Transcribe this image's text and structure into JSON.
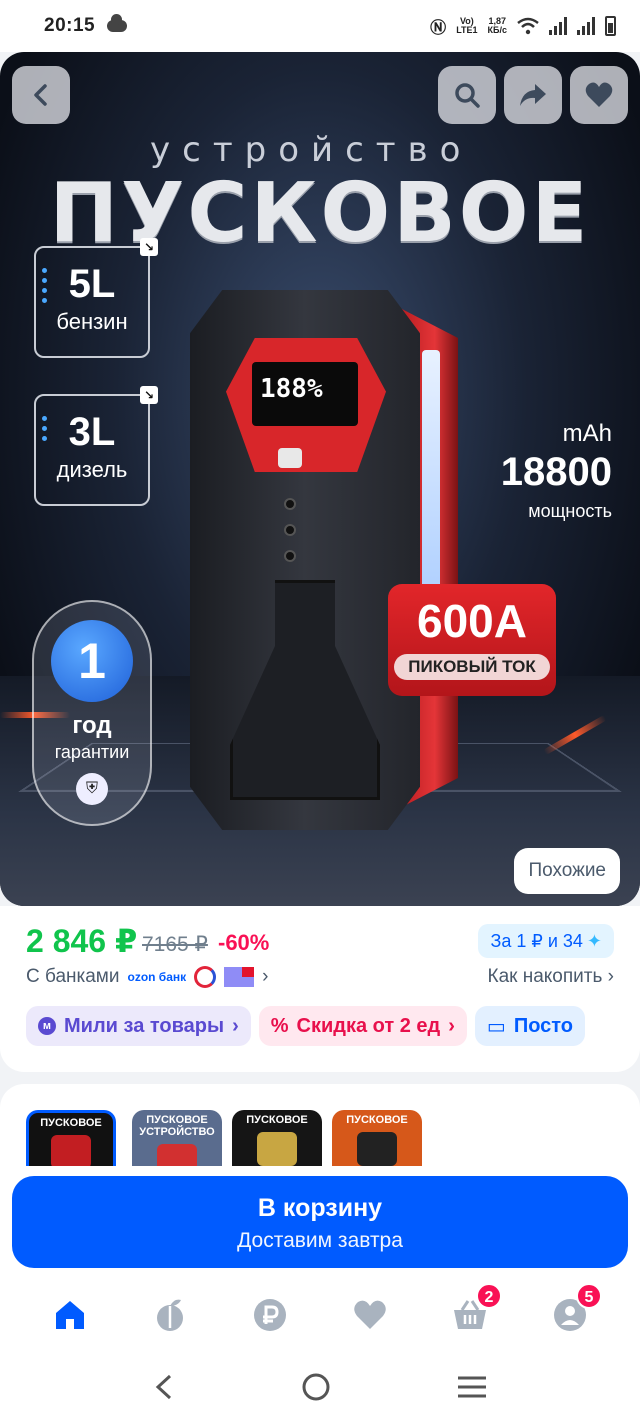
{
  "status_bar": {
    "time": "20:15",
    "lte_top": "Vo)",
    "lte_bottom": "LTE1",
    "speed_top": "1,87",
    "speed_bottom": "КБ/с",
    "icons": [
      "cloud-icon",
      "nfc-icon",
      "wifi-icon",
      "signal-icon",
      "signal-icon",
      "battery-icon"
    ]
  },
  "hero": {
    "subtitle": "устройство",
    "title": "ПУСКОВОЕ",
    "spec1": {
      "value": "5L",
      "label": "бензин"
    },
    "spec2": {
      "value": "3L",
      "label": "дизель"
    },
    "warranty": {
      "number": "1",
      "unit": "год",
      "label": "гарантии"
    },
    "lcd": "188%",
    "capacity": {
      "unit": "mAh",
      "value": "18800",
      "label": "мощность"
    },
    "peak": {
      "value": "600A",
      "label": "ПИКОВЫЙ ТОК"
    },
    "similar_label": "Похожие",
    "buttons": [
      "back-icon",
      "search-icon",
      "share-icon",
      "heart-icon"
    ]
  },
  "price": {
    "current": "2 846 ₽",
    "old": "7165 ₽",
    "discount": "-60%",
    "points": "За 1 ₽ и 34",
    "banks_label": "С банками",
    "ozon_bank": "ozon банк",
    "how_to_save": "Как накопить"
  },
  "promo_chips": [
    {
      "label": "Мили за товары"
    },
    {
      "label": "Скидка от 2 ед"
    },
    {
      "label": "Посто"
    }
  ],
  "variants": [
    {
      "title": "ПУСКОВОЕ",
      "selected": true
    },
    {
      "title": "ПУСКОВОЕ УСТРОЙСТВО",
      "selected": false
    },
    {
      "title": "ПУСКОВОЕ",
      "selected": false
    },
    {
      "title": "ПУСКОВОЕ",
      "selected": false
    }
  ],
  "cart": {
    "label": "В корзину",
    "delivery": "Доставим завтра"
  },
  "bottom_nav": {
    "items": [
      "home-icon",
      "fresh-icon",
      "ruble-icon",
      "favorites-icon",
      "cart-icon",
      "profile-icon"
    ],
    "cart_badge": "2",
    "profile_badge": "5"
  },
  "colors": {
    "accent": "#005bff",
    "price": "#10c44c",
    "discount": "#f91155"
  }
}
